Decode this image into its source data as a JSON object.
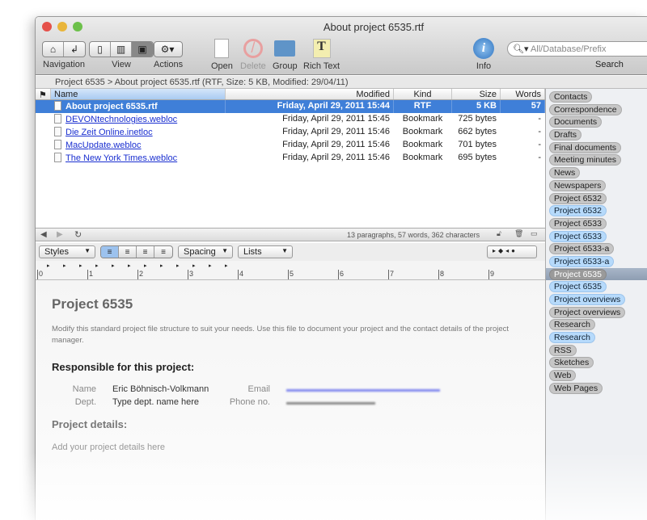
{
  "window": {
    "title": "About project 6535.rtf"
  },
  "toolbar": {
    "navigation": "Navigation",
    "view": "View",
    "actions": "Actions",
    "open": "Open",
    "delete": "Delete",
    "group": "Group",
    "rich_text": "Rich Text",
    "info": "Info",
    "search_label": "Search",
    "search_placeholder": "All/Database/Prefix"
  },
  "path": "Project 6535 > About project 6535.rtf (RTF, Size: 5 KB, Modified: 29/04/11)",
  "table": {
    "columns": [
      "Name",
      "Modified",
      "Kind",
      "Size",
      "Words"
    ],
    "rows": [
      {
        "name": "About project 6535.rtf",
        "modified": "Friday, April 29, 2011 15:44",
        "kind": "RTF",
        "size": "5 KB",
        "words": "57",
        "selected": true
      },
      {
        "name": "DEVONtechnologies.webloc",
        "modified": "Friday, April 29, 2011 15:45",
        "kind": "Bookmark",
        "size": "725 bytes",
        "words": "-"
      },
      {
        "name": "Die Zeit Online.inetloc",
        "modified": "Friday, April 29, 2011 15:46",
        "kind": "Bookmark",
        "size": "662 bytes",
        "words": "-"
      },
      {
        "name": "MacUpdate.webloc",
        "modified": "Friday, April 29, 2011 15:46",
        "kind": "Bookmark",
        "size": "701 bytes",
        "words": "-"
      },
      {
        "name": "The New York Times.webloc",
        "modified": "Friday, April 29, 2011 15:46",
        "kind": "Bookmark",
        "size": "695 bytes",
        "words": "-"
      }
    ]
  },
  "status": "13 paragraphs, 57 words, 362 characters",
  "format": {
    "styles": "Styles",
    "spacing": "Spacing",
    "lists": "Lists"
  },
  "ruler": [
    "0",
    "1",
    "2",
    "3",
    "4",
    "5",
    "6",
    "7",
    "8",
    "9"
  ],
  "doc": {
    "title": "Project 6535",
    "intro": "Modify this standard project file structure to suit your needs. Use this file to document your project and the contact details of the project manager.",
    "responsible": "Responsible for this project:",
    "name_label": "Name",
    "name_value": "Eric Böhnisch-Volkmann",
    "email_label": "Email",
    "dept_label": "Dept.",
    "dept_value": "Type dept. name here",
    "phone_label": "Phone no.",
    "details": "Project details:",
    "details_placeholder": "Add your project details here"
  },
  "tags": [
    {
      "label": "Contacts",
      "color": "gray"
    },
    {
      "label": "Correspondence",
      "color": "gray"
    },
    {
      "label": "Documents",
      "color": "gray"
    },
    {
      "label": "Drafts",
      "color": "gray"
    },
    {
      "label": "Final documents",
      "color": "gray"
    },
    {
      "label": "Meeting minutes",
      "color": "gray"
    },
    {
      "label": "News",
      "color": "gray"
    },
    {
      "label": "Newspapers",
      "color": "gray"
    },
    {
      "label": "Project 6532",
      "color": "gray"
    },
    {
      "label": "Project 6532",
      "color": "blue"
    },
    {
      "label": "Project 6533",
      "color": "gray"
    },
    {
      "label": "Project 6533",
      "color": "blue"
    },
    {
      "label": "Project 6533-a",
      "color": "gray"
    },
    {
      "label": "Project 6533-a",
      "color": "blue"
    },
    {
      "label": "Project 6535",
      "color": "gray",
      "selected": true
    },
    {
      "label": "Project 6535",
      "color": "blue"
    },
    {
      "label": "Project overviews",
      "color": "blue"
    },
    {
      "label": "Project overviews",
      "color": "gray"
    },
    {
      "label": "Research",
      "color": "gray"
    },
    {
      "label": "Research",
      "color": "blue"
    },
    {
      "label": "RSS",
      "color": "gray"
    },
    {
      "label": "Sketches",
      "color": "gray"
    },
    {
      "label": "Web",
      "color": "gray"
    },
    {
      "label": "Web Pages",
      "color": "gray"
    }
  ]
}
